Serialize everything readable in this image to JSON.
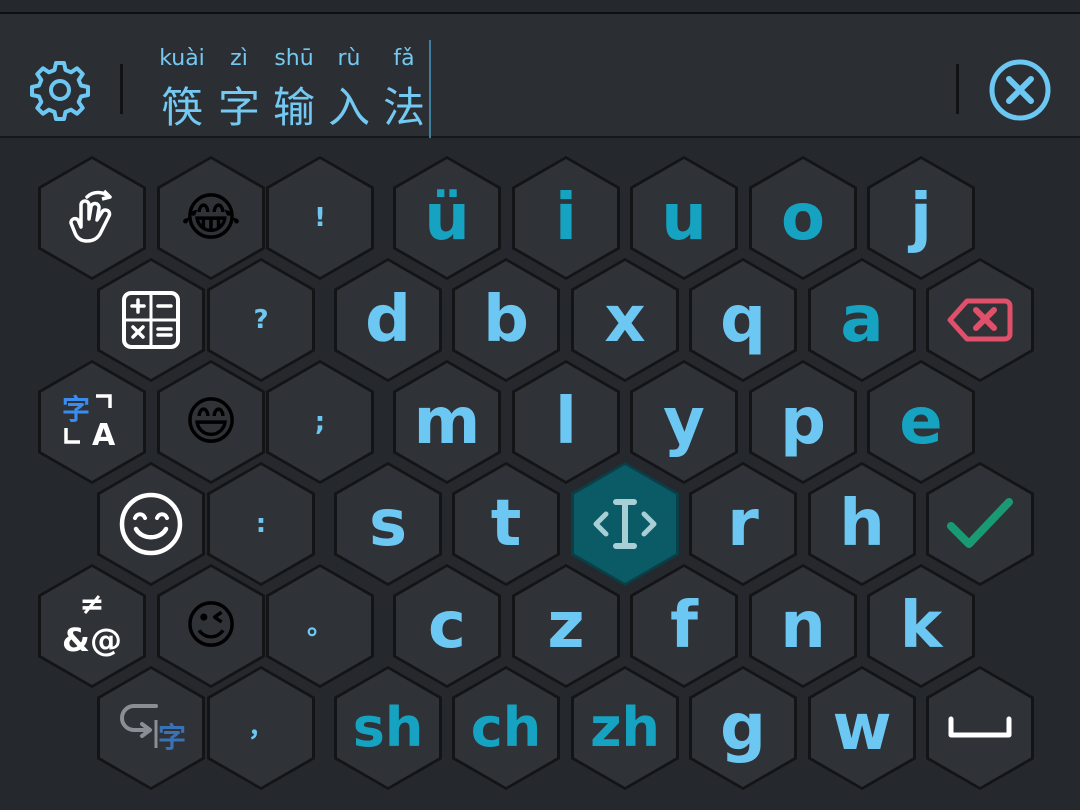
{
  "input_bar": {
    "pinyin": [
      "kuài",
      "zì",
      "shū",
      "rù",
      "fǎ"
    ],
    "hanzi": [
      "筷",
      "字",
      "输",
      "入",
      "法"
    ],
    "settings_icon": "gear-icon",
    "clear_icon": "clear-circle-icon"
  },
  "colors": {
    "background": "#25282c",
    "key_face": "#2f3237",
    "primary_letter": "#6cc8f2",
    "secondary_letter": "#16a3c1",
    "delete_red": "#e0506a",
    "enter_green": "#1a9a73",
    "cursor_key": "#0b5b66"
  },
  "keys": {
    "row1": {
      "symbol": "!",
      "letters": [
        "ü",
        "i",
        "u",
        "o",
        "j"
      ],
      "emoji": "😂"
    },
    "row2": {
      "symbol": "?",
      "letters": [
        "d",
        "b",
        "x",
        "q",
        "a"
      ]
    },
    "row3": {
      "symbol": ";",
      "letters": [
        "m",
        "l",
        "y",
        "p",
        "e"
      ],
      "emoji": "😄",
      "mode_text_top": "字",
      "mode_text_bottom": "A"
    },
    "row4": {
      "symbol": ":",
      "letters": [
        "s",
        "t",
        "r",
        "h"
      ]
    },
    "row5": {
      "symbol": "。",
      "letters": [
        "c",
        "z",
        "f",
        "n",
        "k"
      ],
      "emoji": "😉",
      "symbols_key_top": "≠",
      "symbols_key_bottom": "&@"
    },
    "row6": {
      "symbol": "，",
      "letters": [
        "sh",
        "ch",
        "zh",
        "g",
        "w"
      ],
      "back_key_text": "字"
    }
  }
}
